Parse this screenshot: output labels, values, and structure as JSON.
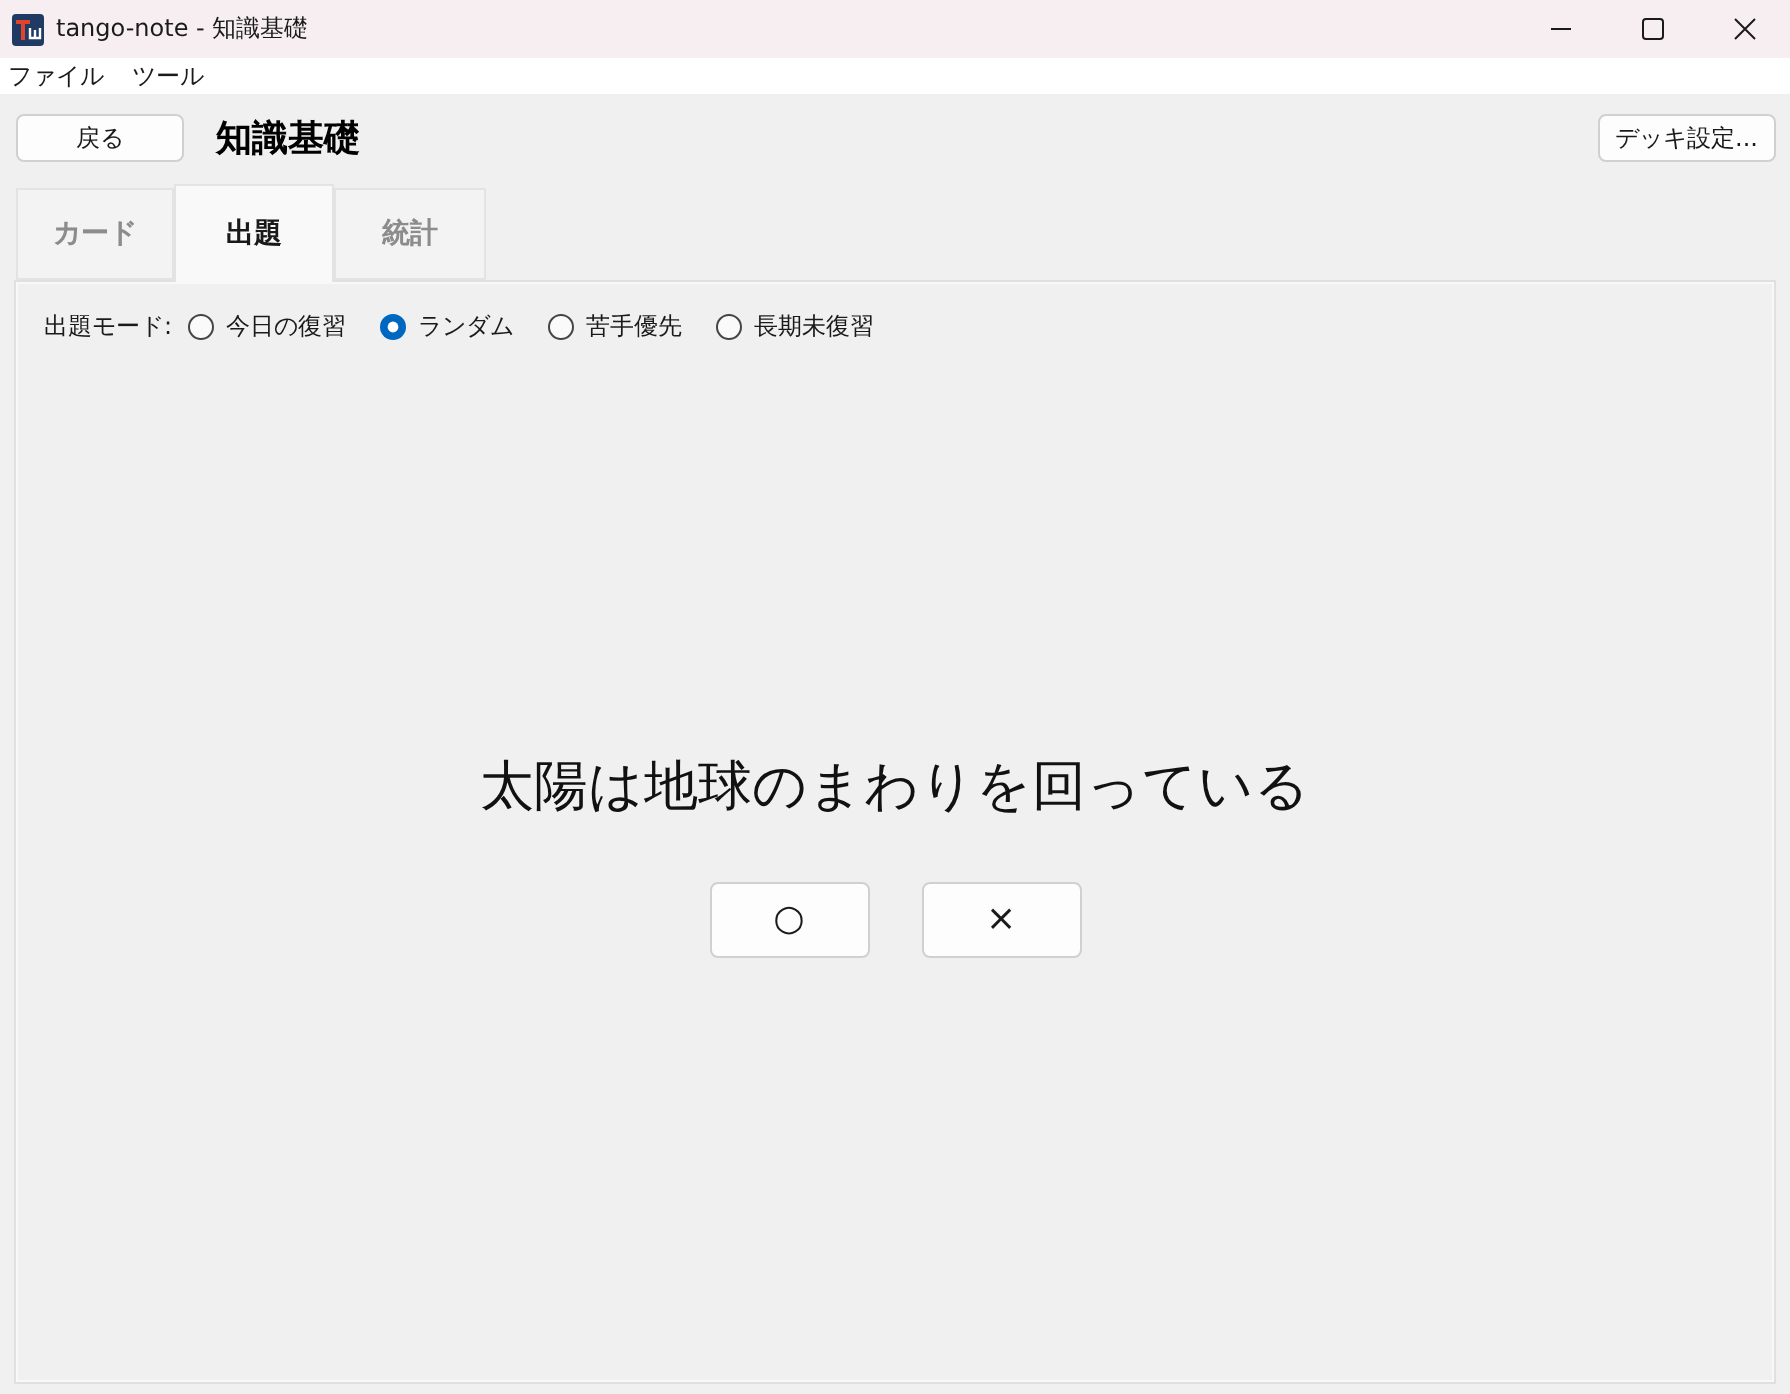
{
  "window": {
    "title": "tango-note - 知識基礎"
  },
  "menu": [
    "ファイル",
    "ツール"
  ],
  "toolbar": {
    "back_button": "戻る",
    "deck_title": "知識基礎",
    "settings_button": "デッキ設定..."
  },
  "tabs": [
    {
      "label": "カード",
      "selected": false
    },
    {
      "label": "出題",
      "selected": true
    },
    {
      "label": "統計",
      "selected": false
    }
  ],
  "mode": {
    "label": "出題モード:",
    "options": [
      {
        "label": "今日の復習",
        "selected": false
      },
      {
        "label": "ランダム",
        "selected": true
      },
      {
        "label": "苦手優先",
        "selected": false
      },
      {
        "label": "長期未復習",
        "selected": false
      }
    ]
  },
  "question": {
    "text": "太陽は地球のまわりを回っている"
  },
  "answer_buttons": [
    "○",
    "×"
  ]
}
